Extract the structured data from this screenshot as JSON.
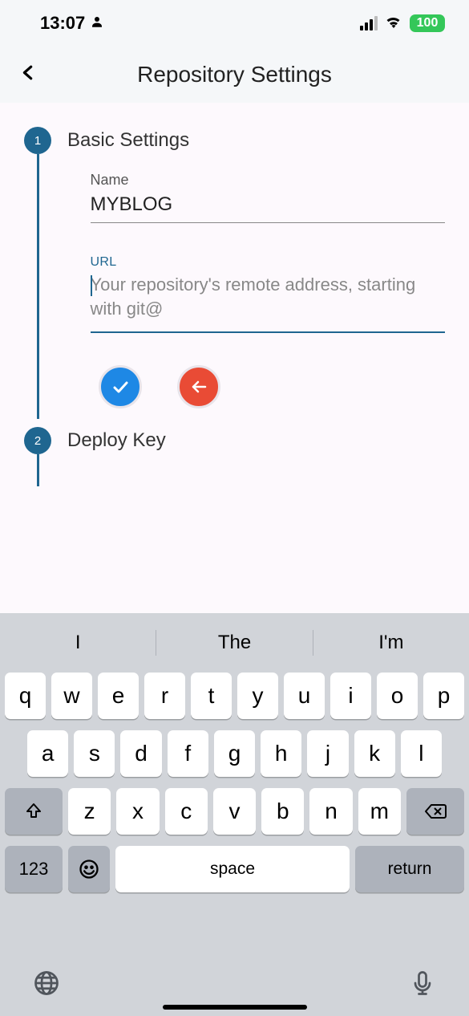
{
  "status": {
    "time": "13:07",
    "battery": "100"
  },
  "nav": {
    "title": "Repository Settings"
  },
  "steps": {
    "basic": {
      "number": "1",
      "title": "Basic Settings",
      "name_label": "Name",
      "name_value": "MYBLOG",
      "url_label": "URL",
      "url_placeholder": "Your repository's remote address, starting with git@"
    },
    "deploy": {
      "number": "2",
      "title": "Deploy Key"
    }
  },
  "keyboard": {
    "suggestions": [
      "I",
      "The",
      "I'm"
    ],
    "row1": [
      "q",
      "w",
      "e",
      "r",
      "t",
      "y",
      "u",
      "i",
      "o",
      "p"
    ],
    "row2": [
      "a",
      "s",
      "d",
      "f",
      "g",
      "h",
      "j",
      "k",
      "l"
    ],
    "row3": [
      "z",
      "x",
      "c",
      "v",
      "b",
      "n",
      "m"
    ],
    "numKey": "123",
    "space": "space",
    "return": "return"
  }
}
